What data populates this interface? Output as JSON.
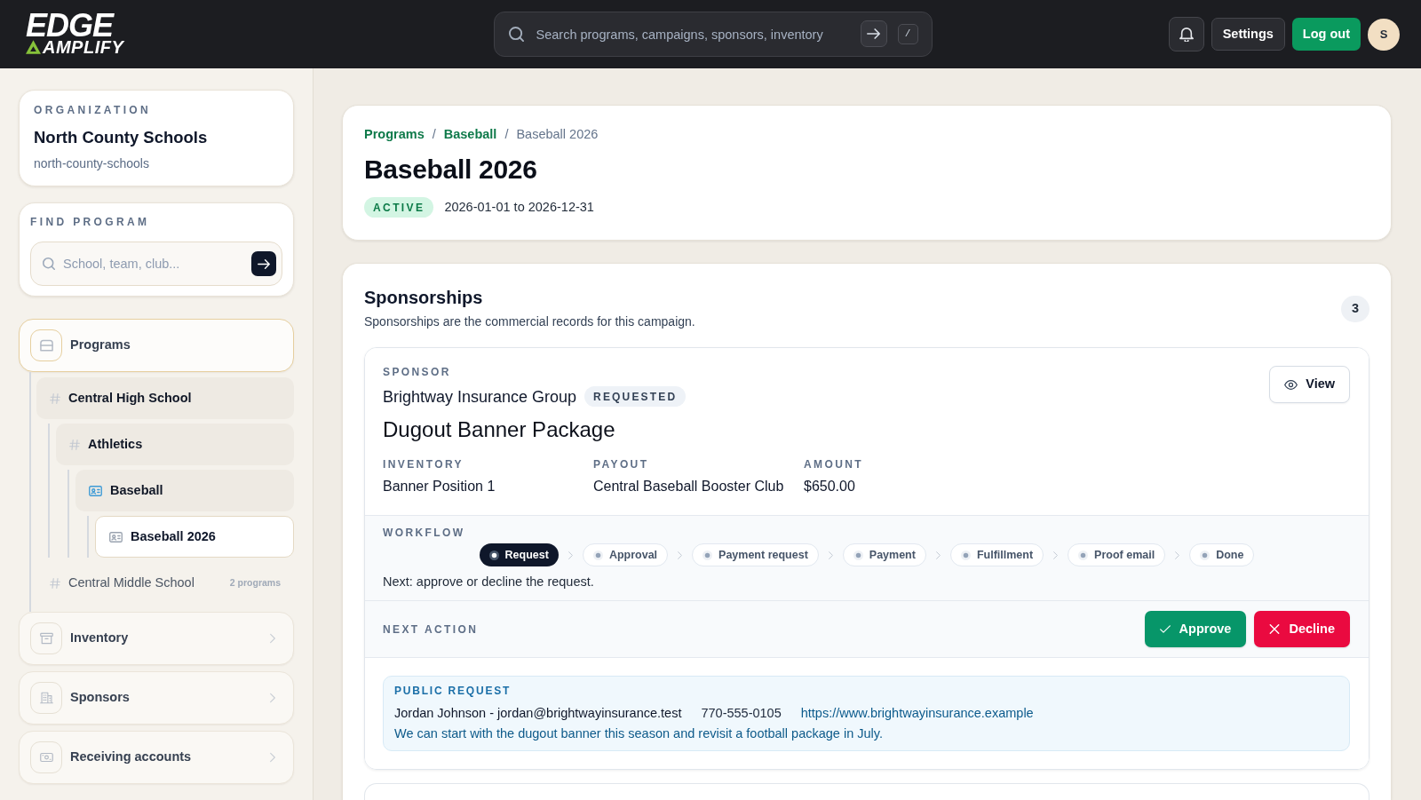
{
  "top_bar": {
    "logo": {
      "line_1": "EDGE",
      "line_2": "AMPLIFY"
    },
    "search": {
      "placeholder": "Search programs, campaigns, sponsors, inventory",
      "shortcut": "/"
    },
    "buttons": [
      {
        "label": "Settings",
        "kind": "settings"
      },
      {
        "label": "Log out",
        "kind": "logout"
      }
    ],
    "avatar": "S"
  },
  "sidebar": {
    "organization": {
      "label": "ORGANIZATION",
      "name": "North County Schools",
      "slug": "north-county-schools"
    },
    "find_program": {
      "label": "FIND PROGRAM",
      "placeholder": "School, team, club..."
    },
    "nav": [
      {
        "label": "Programs",
        "kind": "programs",
        "selected": true,
        "children": [
          {
            "label": "Central High School",
            "kind": "group",
            "selected": false,
            "expanded": true,
            "children": [
              {
                "label": "Athletics",
                "kind": "group",
                "selected": false,
                "expanded": true,
                "children": [
                  {
                    "label": "Baseball",
                    "kind": "team",
                    "selected": false,
                    "expanded": true,
                    "children": [
                      {
                        "label": "Baseball 2026",
                        "kind": "campaign",
                        "selected": true,
                        "expanded": false
                      }
                    ]
                  }
                ]
              }
            ]
          },
          {
            "label": "Central Middle School",
            "kind": "group",
            "selected": false,
            "expanded": false,
            "count": "2 programs"
          }
        ]
      },
      {
        "label": "Inventory",
        "kind": "inventory",
        "selected": false
      },
      {
        "label": "Sponsors",
        "kind": "sponsors",
        "selected": false
      },
      {
        "label": "Receiving accounts",
        "kind": "accounts",
        "selected": false
      }
    ]
  },
  "main": {
    "breadcrumb": {
      "items": [
        {
          "label": "Programs",
          "kind": "link"
        },
        {
          "label": "Baseball",
          "kind": "link"
        },
        {
          "label": "Baseball 2026",
          "kind": "current"
        }
      ],
      "separators": [
        "/",
        "/"
      ]
    },
    "title": "Baseball 2026",
    "status": "ACTIVE",
    "dates": "2026-01-01 to 2026-12-31",
    "sponsorships": {
      "title": "Sponsorships",
      "subtitle": "Sponsorships are the commercial records for this campaign.",
      "count": "3",
      "items": [
        {
          "sponsor_label": "SPONSOR",
          "sponsor": "Brightway Insurance Group",
          "status": "REQUESTED",
          "package": "Dugout Banner Package",
          "view_button": "View",
          "fields": [
            {
              "label": "INVENTORY",
              "value": "Banner Position 1"
            },
            {
              "label": "PAYOUT",
              "value": "Central Baseball Booster Club"
            },
            {
              "label": "AMOUNT",
              "value": "$650.00"
            }
          ],
          "workflow": {
            "label": "WORKFLOW",
            "steps": [
              {
                "label": "Request",
                "selected": true
              },
              {
                "label": "Approval",
                "selected": false
              },
              {
                "label": "Payment request",
                "selected": false
              },
              {
                "label": "Payment",
                "selected": false
              },
              {
                "label": "Fulfillment",
                "selected": false
              },
              {
                "label": "Proof email",
                "selected": false
              },
              {
                "label": "Done",
                "selected": false
              }
            ],
            "next": "Next: approve or decline the request."
          },
          "next_action": {
            "label": "NEXT ACTION",
            "buttons": [
              {
                "label": "Approve",
                "kind": "approve"
              },
              {
                "label": "Decline",
                "kind": "decline"
              }
            ]
          },
          "public_request": {
            "label": "PUBLIC REQUEST",
            "contact": "Jordan Johnson - jordan@brightwayinsurance.test",
            "phone": "770-555-0105",
            "website": "https://www.brightwayinsurance.example",
            "message": "We can start with the dugout banner this season and revisit a football package in July."
          }
        }
      ]
    }
  }
}
